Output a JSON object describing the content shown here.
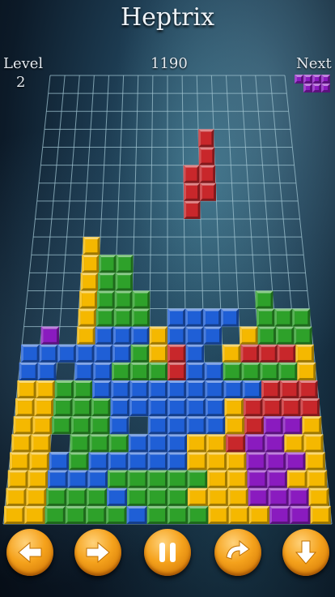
{
  "header": {
    "title": "Heptrix"
  },
  "stats": {
    "level_label": "Level",
    "level": "2",
    "score": "1190",
    "next_label": "Next"
  },
  "colors": {
    "yellow": "#f5b800",
    "green": "#2ea12a",
    "blue": "#1f5fd6",
    "red": "#c8272b",
    "purple": "#8a1bbf",
    "grid": "#9fc3d0",
    "button": "#f5a21c"
  },
  "board": {
    "columns": 14,
    "rows": 23,
    "grid_color": "#9fc3d0",
    "cells": [
      "..............",
      "..............",
      "..............",
      "..........R...",
      "..........R...",
      ".........RR...",
      ".........RR...",
      ".........R....",
      "..............",
      "...Y..........",
      "...YGG........",
      "...YGG........",
      "...YGGG......G",
      "...YGGG.BBBB.GGG",
      ".P.YBBBYBBB.YGGG",
      "BBBBBBGYRB.YRRRY",
      "BB.BBGGGRBBGGGGY",
      "YYGGBBBBBBBBBRRR",
      "YYGGGBBBBBBYRRRR",
      "YYGGGB.BBBBYRPPY",
      "YY.GGGBBBYYRPPYY",
      "YYBGBBBBBYYYPPPY",
      "YYBBBGGGGGYYPPYY"
    ],
    "bottom_rows": [
      "YYGGGBGGGYYYPPPY",
      "YYGGGGBGGGYYYPPY"
    ]
  },
  "falling_piece": {
    "color": "red",
    "shape": "S-heptomino"
  },
  "next_piece": {
    "color": "purple",
    "cells": [
      "1111",
      ".111"
    ]
  },
  "controls": [
    {
      "name": "move-left",
      "icon": "arrow-left-icon"
    },
    {
      "name": "move-right",
      "icon": "arrow-right-icon"
    },
    {
      "name": "pause",
      "icon": "pause-icon"
    },
    {
      "name": "rotate",
      "icon": "rotate-icon"
    },
    {
      "name": "drop",
      "icon": "arrow-down-icon"
    }
  ]
}
